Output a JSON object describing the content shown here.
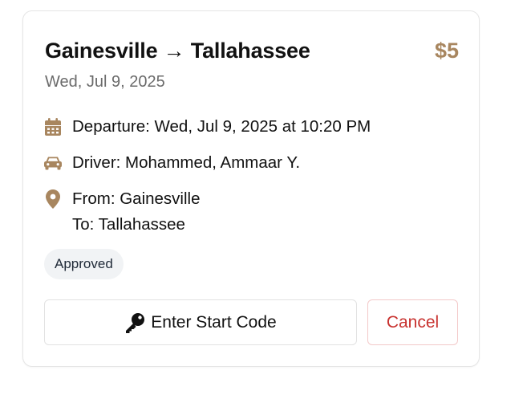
{
  "ride": {
    "route_title": "Gainesville → Tallahassee",
    "price": "$5",
    "date": "Wed, Jul 9, 2025",
    "departure": "Departure: Wed, Jul 9, 2025 at 10:20 PM",
    "driver": "Driver: Mohammed, Ammaar Y.",
    "from": "From: Gainesville",
    "to": "To: Tallahassee",
    "status": "Approved"
  },
  "actions": {
    "start_code_label": "Enter Start Code",
    "cancel_label": "Cancel"
  },
  "icons": {
    "departure": "calendar-icon",
    "driver": "car-icon",
    "location": "map-pin-icon",
    "start_code": "key-icon"
  },
  "colors": {
    "accent": "#a8865f",
    "cancel": "#c8322f",
    "badge_bg": "#f1f3f5"
  }
}
